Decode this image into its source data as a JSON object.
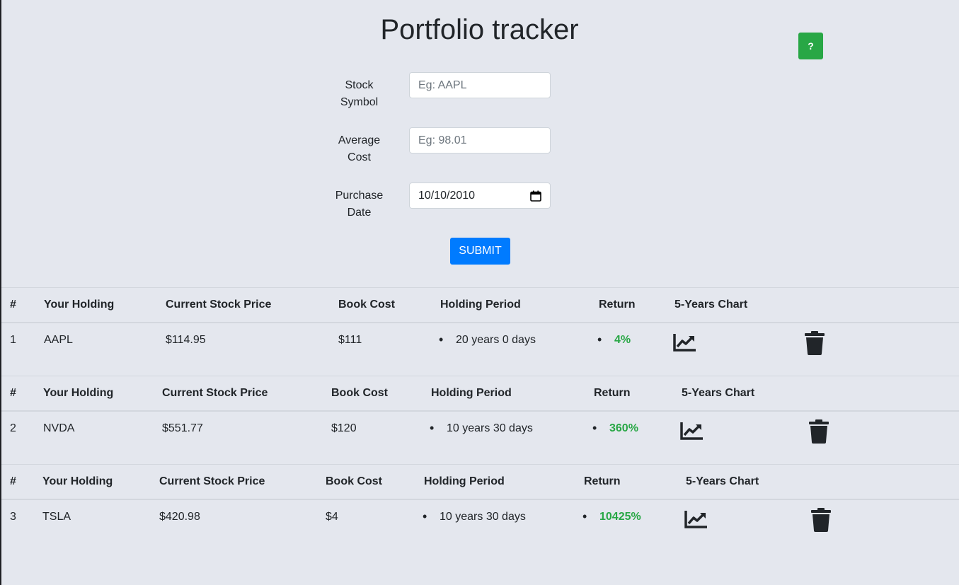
{
  "title": "Portfolio tracker",
  "help_label": "?",
  "form": {
    "symbol_label_line1": "Stock",
    "symbol_label_line2": "Symbol",
    "symbol_placeholder": "Eg: AAPL",
    "cost_label_line1": "Average",
    "cost_label_line2": "Cost",
    "cost_placeholder": "Eg: 98.01",
    "date_label_line1": "Purchase",
    "date_label_line2": "Date",
    "date_value": "10/10/2010",
    "submit_label": "SUBMIT"
  },
  "table_headers": {
    "index": "#",
    "holding": "Your Holding",
    "price": "Current Stock Price",
    "book_cost": "Book Cost",
    "period": "Holding Period",
    "return": "Return",
    "chart": "5-Years Chart"
  },
  "rows": [
    {
      "index": "1",
      "holding": "AAPL",
      "price": "$114.95",
      "book_cost": "$111",
      "period": "20 years 0 days",
      "return": "4%"
    },
    {
      "index": "2",
      "holding": "NVDA",
      "price": "$551.77",
      "book_cost": "$120",
      "period": "10 years 30 days",
      "return": "360%"
    },
    {
      "index": "3",
      "holding": "TSLA",
      "price": "$420.98",
      "book_cost": "$4",
      "period": "10 years 30 days",
      "return": "10425%"
    }
  ],
  "icons": {
    "chart": "chart-line-icon",
    "delete": "trash-icon",
    "calendar": "calendar-icon"
  },
  "colors": {
    "primary": "#007bff",
    "success": "#28a745",
    "background": "#e4e7ee"
  }
}
